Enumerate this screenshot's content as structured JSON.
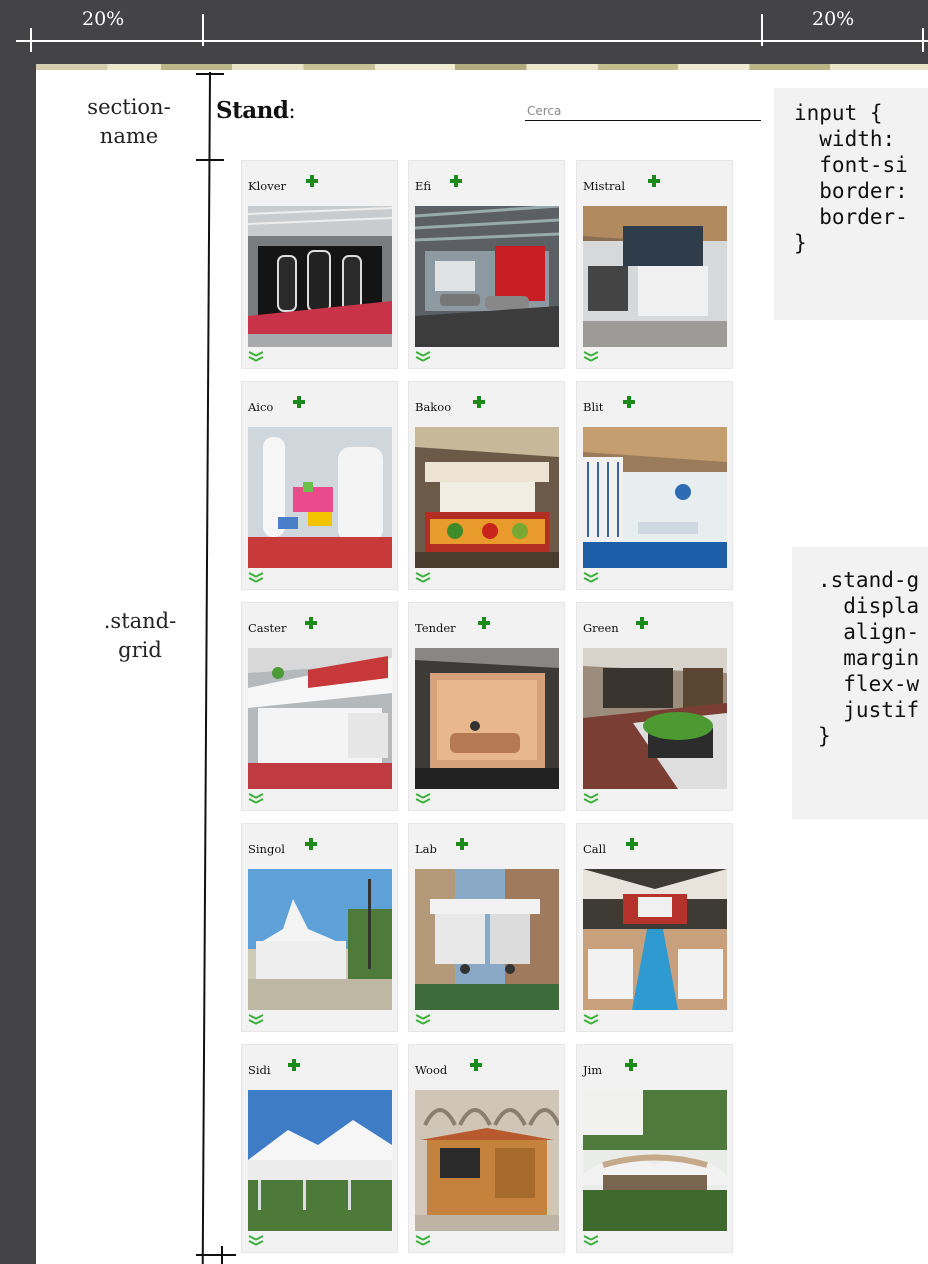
{
  "ruler": {
    "left_label": "20%",
    "right_label": "20%"
  },
  "labels": {
    "section_name": "section-\nname",
    "stand_grid": ".stand-\ngrid"
  },
  "section": {
    "title": "Stand",
    "separator": ":"
  },
  "search": {
    "placeholder": "Cerca",
    "value": ""
  },
  "code_blocks": {
    "input_rule": "input {\n  width:\n  font-si\n  border:\n  border-\n}",
    "grid_rule": ".stand-g\n  displa\n  align-\n  margin\n  flex-w\n  justif\n}"
  },
  "colors": {
    "background": "#444447",
    "accent_green": "#1b8a1b",
    "chevron_green": "#3bb03b",
    "card_bg": "#f2f2f2"
  },
  "icons": {
    "add": "plus-icon",
    "expand": "double-chevron-down-icon"
  },
  "stands": [
    {
      "name": "Klover"
    },
    {
      "name": "Efi"
    },
    {
      "name": "Mistral"
    },
    {
      "name": "Aico"
    },
    {
      "name": "Bakoo"
    },
    {
      "name": "Blit"
    },
    {
      "name": "Caster"
    },
    {
      "name": "Tender"
    },
    {
      "name": "Green"
    },
    {
      "name": "Singol"
    },
    {
      "name": "Lab"
    },
    {
      "name": "Call"
    },
    {
      "name": "Sidi"
    },
    {
      "name": "Wood"
    },
    {
      "name": "Jim"
    }
  ]
}
